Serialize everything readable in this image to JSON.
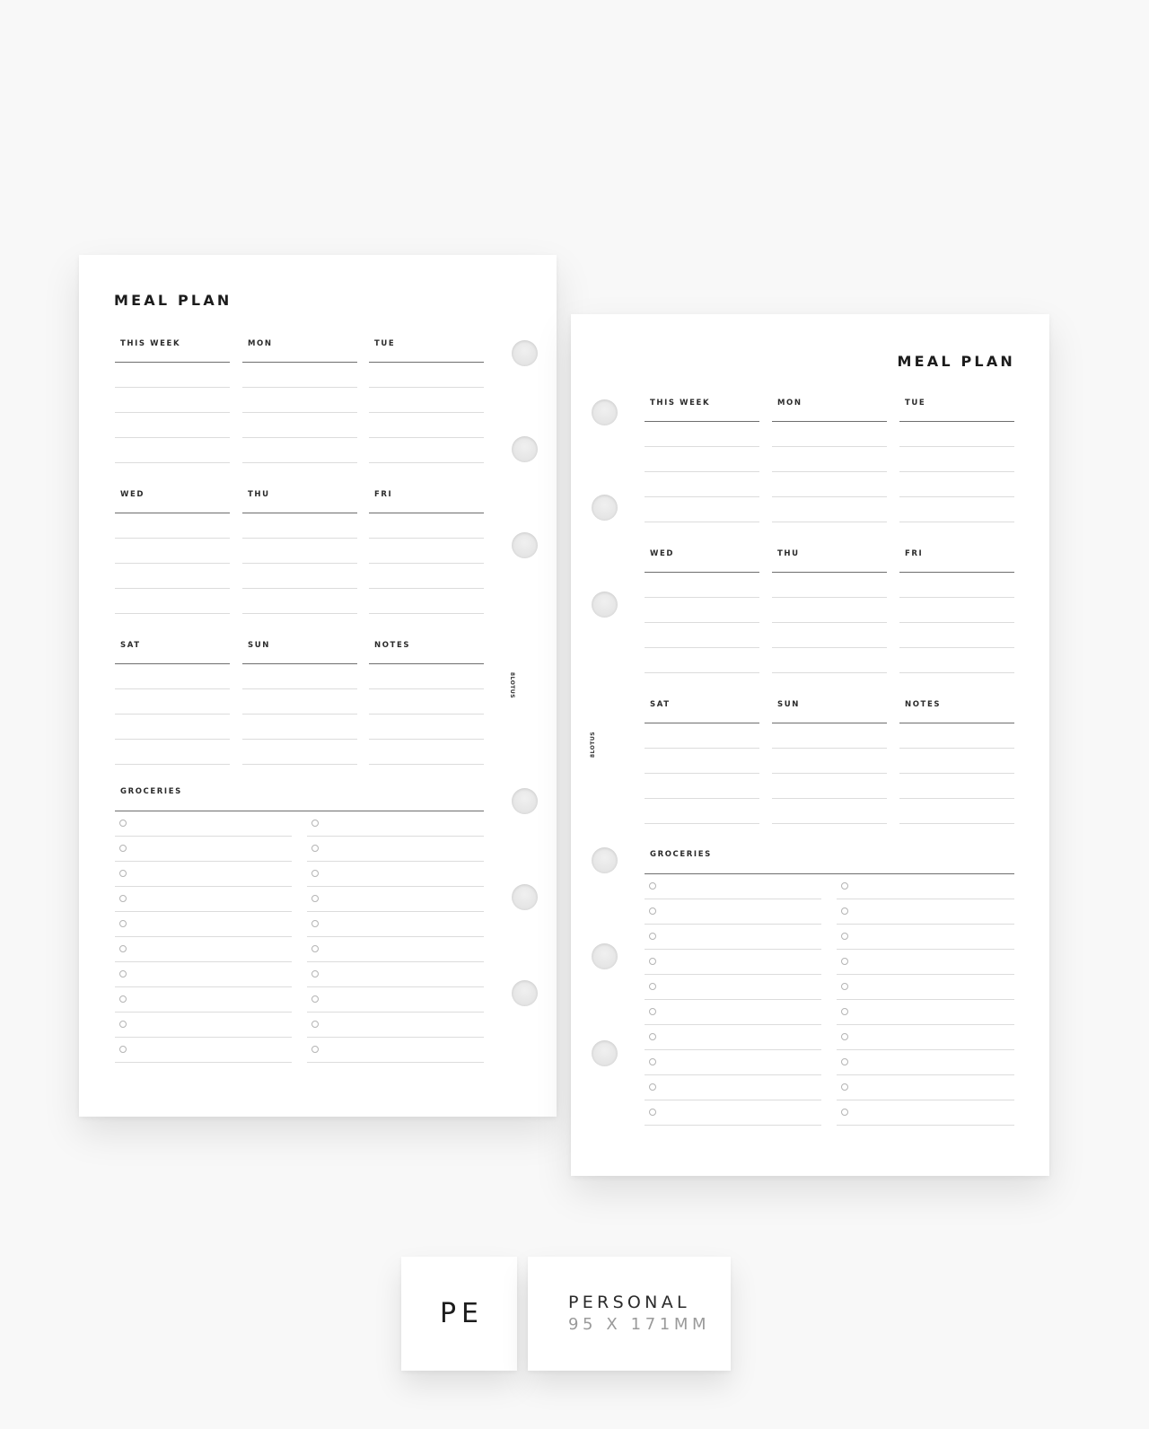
{
  "pages": [
    {
      "side": "left",
      "title": "MEAL PLAN",
      "brand": "8LOTUS",
      "sections": [
        [
          "THIS WEEK",
          "MON",
          "TUE"
        ],
        [
          "WED",
          "THU",
          "FRI"
        ],
        [
          "SAT",
          "SUN",
          "NOTES"
        ]
      ],
      "lines_per_section": 4,
      "groceries": {
        "label": "GROCERIES",
        "columns": 2,
        "items_per_column": 10
      },
      "holes": 6
    },
    {
      "side": "right",
      "title": "MEAL PLAN",
      "brand": "8LOTUS",
      "sections": [
        [
          "THIS WEEK",
          "MON",
          "TUE"
        ],
        [
          "WED",
          "THU",
          "FRI"
        ],
        [
          "SAT",
          "SUN",
          "NOTES"
        ]
      ],
      "lines_per_section": 4,
      "groceries": {
        "label": "GROCERIES",
        "columns": 2,
        "items_per_column": 10
      },
      "holes": 6
    }
  ],
  "size_badge": {
    "code": "PE",
    "name": "PERSONAL",
    "dimensions": "95 X 171MM"
  },
  "colors": {
    "background": "#f8f8f8",
    "paper": "#ffffff",
    "rule_dark": "#6e6e6e",
    "rule_light": "#dcdcdc",
    "text": "#1c1c1c",
    "dims_text": "#9a9a9a"
  }
}
